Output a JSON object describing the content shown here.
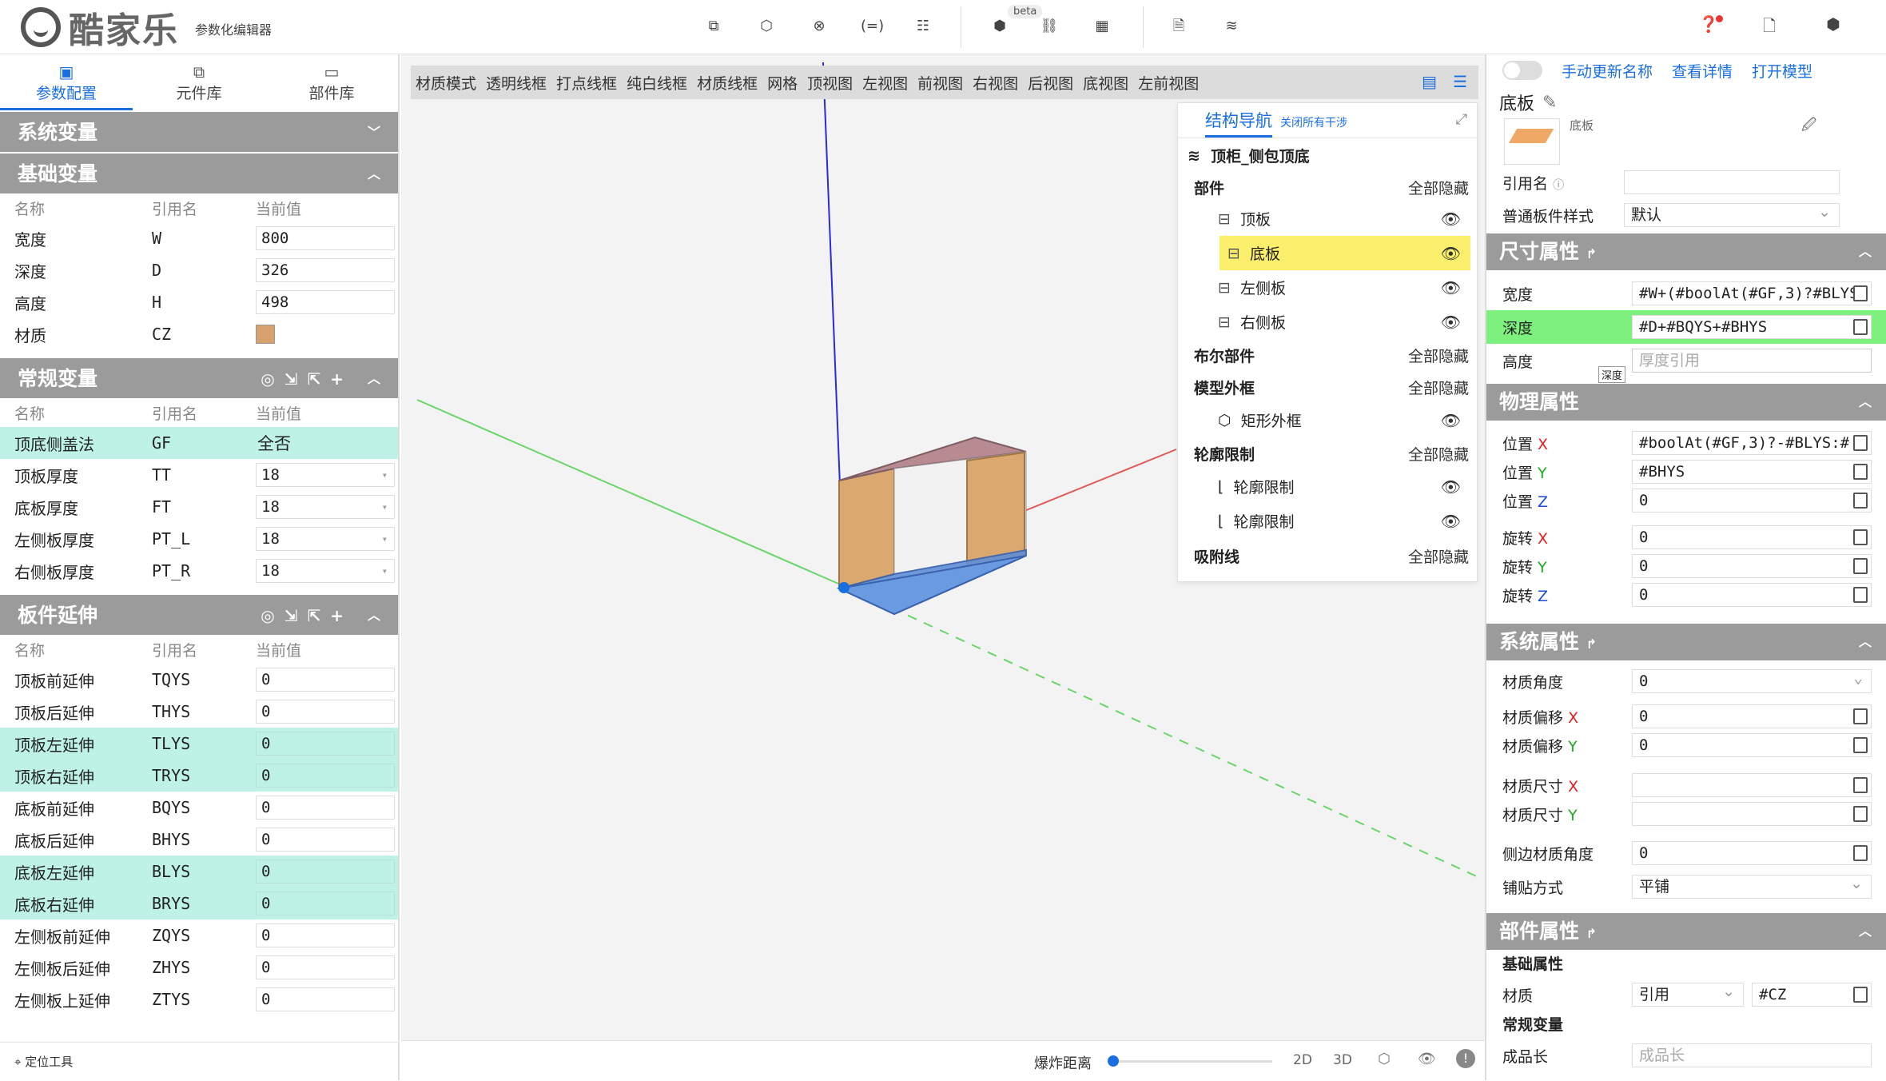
{
  "app": {
    "brand": "酷家乐",
    "subtitle": "参数化编辑器",
    "beta": "beta"
  },
  "left": {
    "tabs": [
      {
        "label": "参数配置",
        "icon": "param-icon"
      },
      {
        "label": "元件库",
        "icon": "component-icon"
      },
      {
        "label": "部件库",
        "icon": "part-icon"
      }
    ],
    "sections": {
      "system": "系统变量",
      "basic": "基础变量",
      "normal": "常规变量",
      "extend": "板件延伸"
    },
    "headers": {
      "name": "名称",
      "ref": "引用名",
      "value": "当前值"
    },
    "basic_rows": [
      [
        "宽度",
        "W",
        "800"
      ],
      [
        "深度",
        "D",
        "326"
      ],
      [
        "高度",
        "H",
        "498"
      ],
      [
        "材质",
        "CZ",
        ""
      ]
    ],
    "normal_rows": [
      [
        "顶底侧盖法",
        "GF",
        "全否"
      ],
      [
        "顶板厚度",
        "TT",
        "18"
      ],
      [
        "底板厚度",
        "FT",
        "18"
      ],
      [
        "左侧板厚度",
        "PT_L",
        "18"
      ],
      [
        "右侧板厚度",
        "PT_R",
        "18"
      ]
    ],
    "extend_rows": [
      [
        "顶板前延伸",
        "TQYS",
        "0"
      ],
      [
        "顶板后延伸",
        "THYS",
        "0"
      ],
      [
        "顶板左延伸",
        "TLYS",
        "0"
      ],
      [
        "顶板右延伸",
        "TRYS",
        "0"
      ],
      [
        "底板前延伸",
        "BQYS",
        "0"
      ],
      [
        "底板后延伸",
        "BHYS",
        "0"
      ],
      [
        "底板左延伸",
        "BLYS",
        "0"
      ],
      [
        "底板右延伸",
        "BRYS",
        "0"
      ],
      [
        "左侧板前延伸",
        "ZQYS",
        "0"
      ],
      [
        "左侧板后延伸",
        "ZHYS",
        "0"
      ],
      [
        "左侧板上延伸",
        "ZTYS",
        "0"
      ]
    ],
    "locate": "定位工具"
  },
  "view": {
    "toolbar": [
      "材质模式",
      "透明线框",
      "打点线框",
      "纯白线框",
      "材质线框",
      "网格",
      "顶视图",
      "左视图",
      "前视图",
      "右视图",
      "后视图",
      "底视图",
      "左前视图"
    ],
    "explode": "爆炸距离",
    "btn2d": "2D",
    "btn3d": "3D"
  },
  "nav": {
    "title": "结构导航",
    "close_all": "关闭所有干涉",
    "root": "顶柜_侧包顶底",
    "groups": {
      "parts": "部件",
      "bool": "布尔部件",
      "frame": "模型外框",
      "outline": "轮廓限制",
      "adsorb": "吸附线"
    },
    "hide_all": "全部隐藏",
    "parts": [
      "顶板",
      "底板",
      "左侧板",
      "右侧板"
    ],
    "frame": "矩形外框",
    "outline": [
      "轮廓限制",
      "轮廓限制"
    ]
  },
  "right": {
    "links": [
      "手动更新名称",
      "查看详情",
      "打开模型"
    ],
    "name": "底板",
    "thumb_label": "底板",
    "ref_label": "引用名",
    "style_label": "普通板件样式",
    "style_value": "默认",
    "size": {
      "title": "尺寸属性",
      "width_label": "宽度",
      "width": "#W+(#boolAt(#GF,3)?#BLYS",
      "depth_label": "深度",
      "depth": "#D+#BQYS+#BHYS",
      "height_label": "高度",
      "height_ph": "厚度引用",
      "tooltip": "深度"
    },
    "phys": {
      "title": "物理属性",
      "pos_label": "位置",
      "rot_label": "旋转",
      "px": "#boolAt(#GF,3)?-#BLYS:#",
      "py": "#BHYS",
      "pz": "0",
      "rx": "0",
      "ry": "0",
      "rz": "0"
    },
    "sys": {
      "title": "系统属性",
      "angle_label": "材质角度",
      "angle": "0",
      "offset_label": "材质偏移",
      "ox": "0",
      "oy": "0",
      "size_label": "材质尺寸",
      "edge_label": "侧边材质角度",
      "edge": "0",
      "tile_label": "铺贴方式",
      "tile": "平铺"
    },
    "part": {
      "title": "部件属性",
      "basic": "基础属性",
      "mat_label": "材质",
      "mat_mode": "引用",
      "mat": "#CZ",
      "normal": "常规变量",
      "len_label": "成品长",
      "len_ph": "成品长"
    },
    "axes": {
      "x": "X",
      "y": "Y",
      "z": "Z"
    },
    "colors": {
      "x": "#e02020",
      "y": "#1faa1f",
      "z": "#1a4fd6"
    }
  }
}
